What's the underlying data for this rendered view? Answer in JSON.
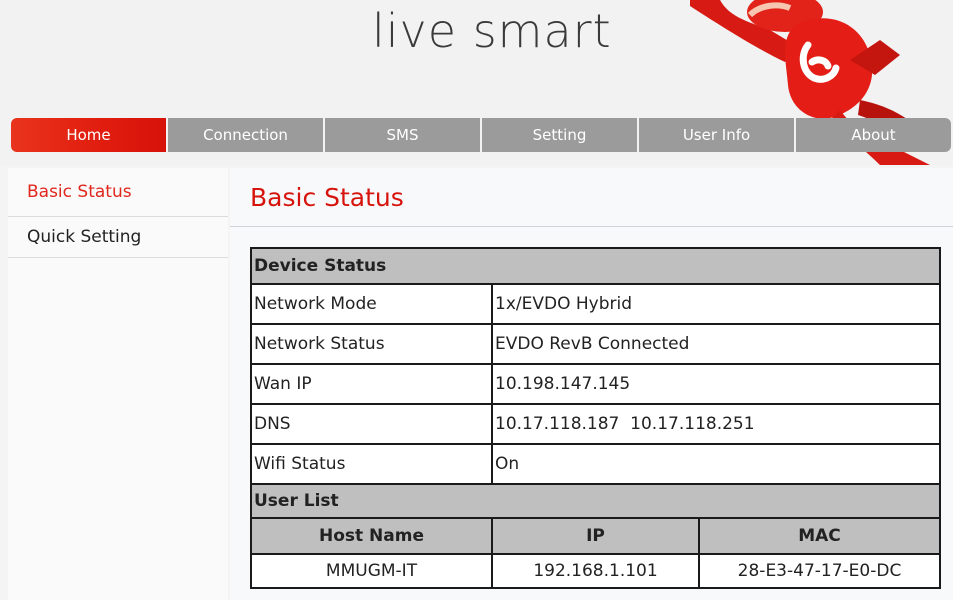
{
  "header": {
    "brand_text": "live smart"
  },
  "nav": {
    "items": [
      {
        "label": "Home",
        "active": true
      },
      {
        "label": "Connection"
      },
      {
        "label": "SMS"
      },
      {
        "label": "Setting"
      },
      {
        "label": "User Info"
      },
      {
        "label": "About"
      }
    ]
  },
  "sidebar": {
    "items": [
      {
        "label": "Basic Status",
        "active": true
      },
      {
        "label": "Quick Setting"
      }
    ]
  },
  "main": {
    "title": "Basic Status",
    "device_status": {
      "heading": "Device Status",
      "rows": [
        {
          "label": "Network Mode",
          "value": "1x/EVDO Hybrid"
        },
        {
          "label": "Network Status",
          "value": "EVDO RevB Connected"
        },
        {
          "label": "Wan IP",
          "value": "10.198.147.145"
        },
        {
          "label": "DNS",
          "value": "10.17.118.187  10.17.118.251"
        },
        {
          "label": "Wifi Status",
          "value": "On"
        }
      ]
    },
    "user_list": {
      "heading": "User List",
      "columns": [
        "Host Name",
        "IP",
        "MAC"
      ],
      "rows": [
        [
          "MMUGM-IT",
          "192.168.1.101",
          "28-E3-47-17-E0-DC"
        ]
      ]
    }
  },
  "colors": {
    "accent": "#e1261c",
    "nav_gray": "#9b9b9b",
    "section_gray": "#bfbfbf"
  }
}
